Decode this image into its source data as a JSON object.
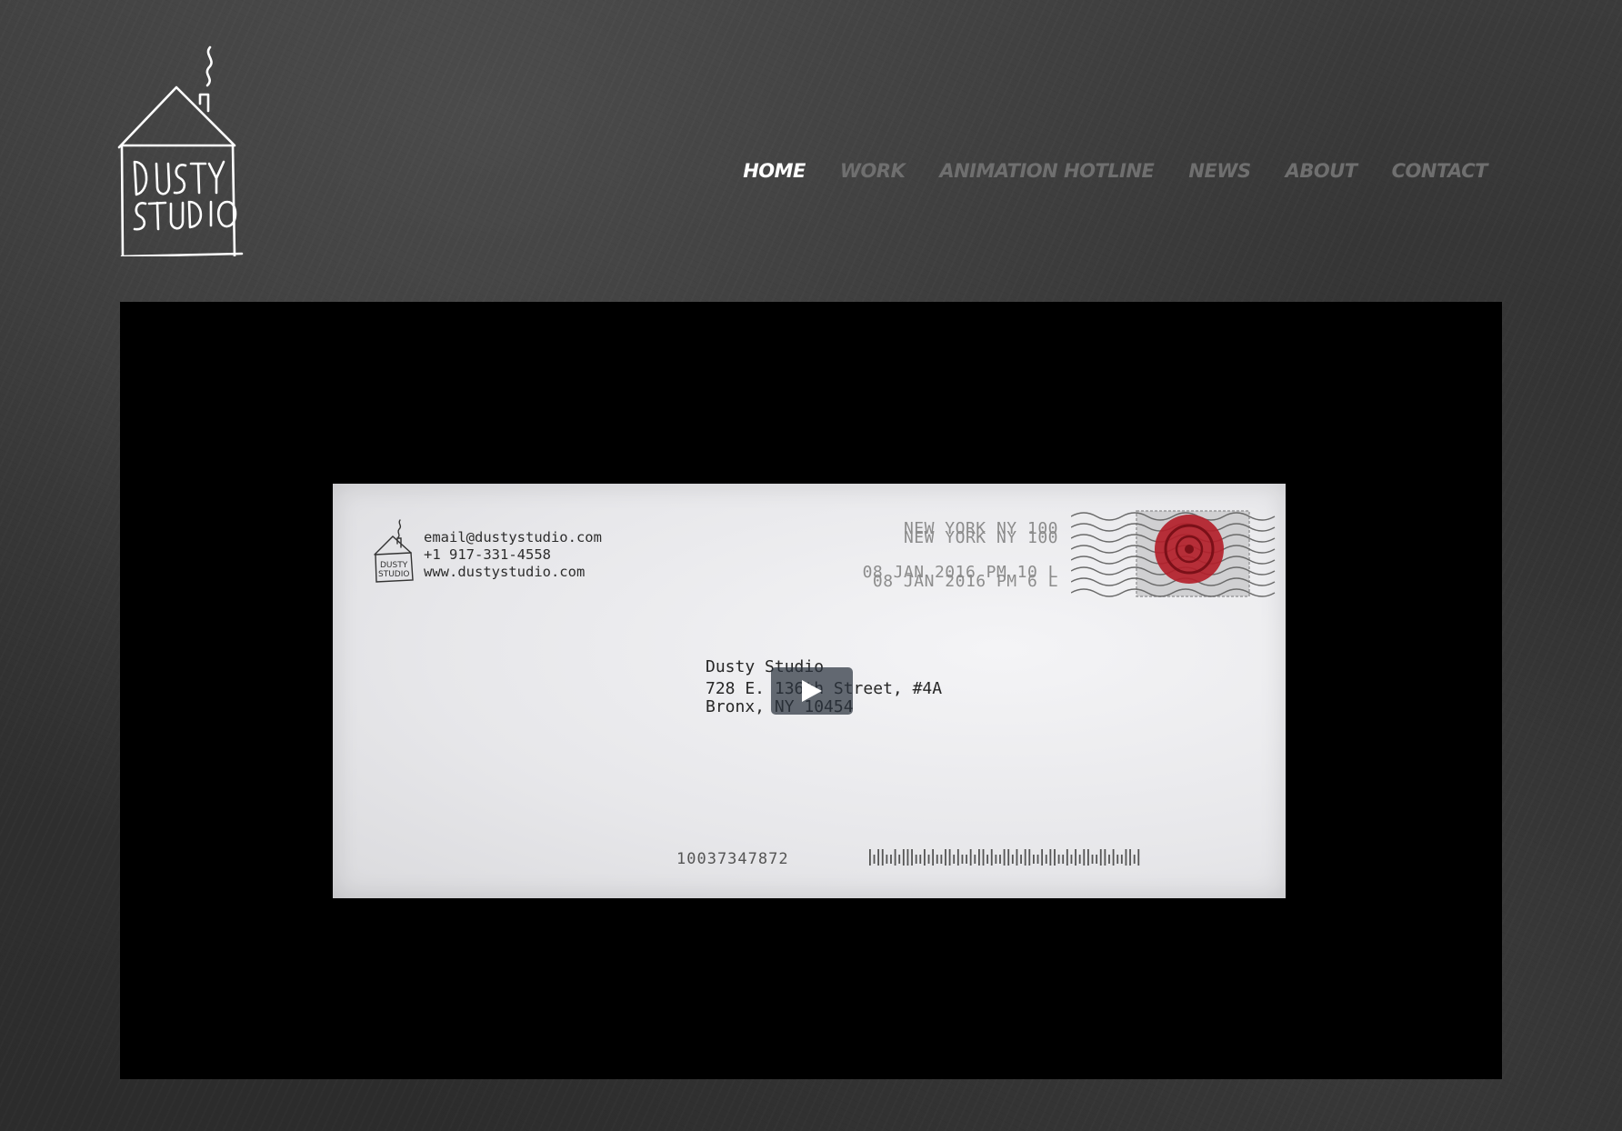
{
  "site": {
    "logo_alt": "DUSTY STUDIO"
  },
  "nav": {
    "items": [
      {
        "label": "HOME",
        "active": true
      },
      {
        "label": "WORK",
        "active": false
      },
      {
        "label": "ANIMATION HOTLINE",
        "active": false
      },
      {
        "label": "NEWS",
        "active": false
      },
      {
        "label": "ABOUT",
        "active": false
      },
      {
        "label": "CONTACT",
        "active": false
      }
    ]
  },
  "video": {
    "envelope": {
      "return_address": {
        "email": "email@dustystudio.com",
        "phone": "+1 917-331-4558",
        "web": "www.dustystudio.com"
      },
      "postmark": {
        "line1a": "NEW YORK NY 100",
        "line1b": "NEW YORK NY 100",
        "line2a": "08 JAN 2016  PM 10 L",
        "line2b": "08 JAN 2016  PM 6 L"
      },
      "recipient": {
        "name": "Dusty Studio",
        "street": "728 E. 136th Street, #4A",
        "city": "Bronx, NY  10454"
      },
      "tracking_number": "10037347872"
    },
    "play_button": "play-icon"
  },
  "colors": {
    "nav_active": "#ffffff",
    "nav_inactive": "#6f6f6f",
    "background": "#333333",
    "video_bg": "#000000",
    "stamp_red": "#b3202a"
  }
}
